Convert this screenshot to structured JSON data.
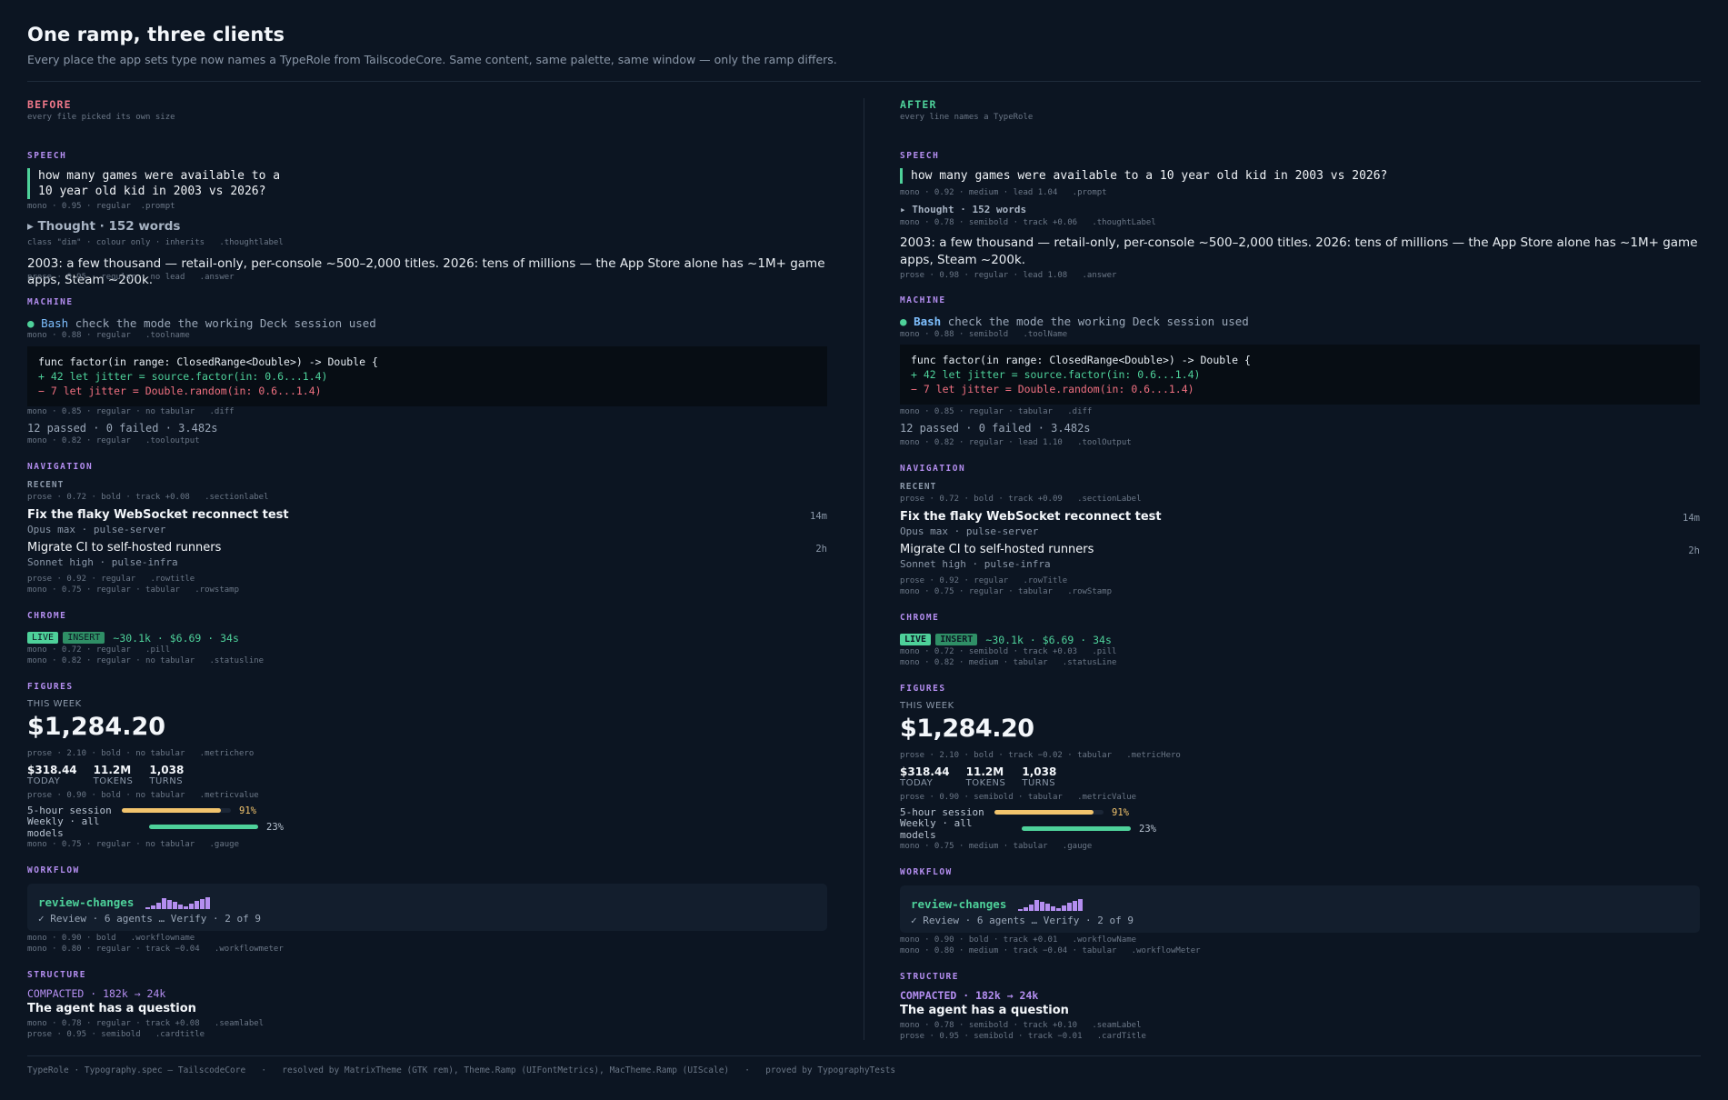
{
  "header": {
    "title": "One ramp, three clients",
    "subtitle": "Every place the app sets type now names a TypeRole from TailscodeCore. Same content, same palette, same window — only the ramp differs."
  },
  "sections": {
    "speech": "SPEECH",
    "machine": "MACHINE",
    "navigation": "NAVIGATION",
    "chrome": "CHROME",
    "figures": "FIGURES",
    "workflow": "WORKFLOW",
    "structure": "STRUCTURE"
  },
  "content": {
    "prompt_wrapped": [
      "how many games were available to a",
      "10 year old kid in 2003 vs 2026?"
    ],
    "prompt": "how many games were available to a 10 year old kid in 2003 vs 2026?",
    "thought": "▸ Thought · 152 words",
    "answer": "2003: a few thousand — retail-only, per-console ~500–2,000 titles. 2026: tens of millions — the App Store alone has ~1M+ game apps, Steam ~200k.",
    "tool_dot": "●",
    "tool_name": "Bash",
    "tool_args": "check the mode the working Deck session used",
    "diff": [
      "func factor(in range: ClosedRange<Double>) -> Double {",
      "+  42   let jitter = source.factor(in: 0.6...1.4)",
      "−   7   let jitter = Double.random(in: 0.6...1.4)"
    ],
    "tool_output": "12 passed · 0 failed · 3.482s",
    "recent_label": "RECENT",
    "rows": [
      {
        "title": "Fix the flaky WebSocket reconnect test",
        "sub": "Opus  max · pulse-server",
        "stamp": "14m"
      },
      {
        "title": "Migrate CI to self-hosted runners",
        "sub": "Sonnet  high · pulse-infra",
        "stamp": "2h"
      }
    ],
    "pill_live": "LIVE",
    "pill_insert": "INSERT",
    "statusline": "~30.1k · $6.69 · 34s",
    "this_week": "THIS WEEK",
    "metric_hero": "$1,284.20",
    "metrics": [
      {
        "value": "$318.44",
        "label": "TODAY"
      },
      {
        "value": "11.2M",
        "label": "TOKENS"
      },
      {
        "value": "1,038",
        "label": "TURNS"
      }
    ],
    "gauges": [
      {
        "label": "5-hour session",
        "pct_text": "91%",
        "fraction": 0.91,
        "color": "#f2c46d"
      },
      {
        "label": "Weekly · all models",
        "pct_text": "23%",
        "fraction": 1.0,
        "color": "#4ed19a"
      }
    ],
    "workflow_name": "review-changes",
    "workflow_meter": "✓ Review · 6 agents   … Verify · 2 of 9",
    "compacted": "COMPACTED · 182k → 24k",
    "card_title": "The agent has a question"
  },
  "before": {
    "label": "BEFORE",
    "label_color": "#f0788a",
    "sub": "every file picked its own size",
    "meta": {
      "prompt": "mono · 0.95 · regular  .prompt",
      "thought": "class \"dim\" · colour only · inherits   .thoughtlabel",
      "answer": "prose · 0.95 · regular · no lead   .answer",
      "toolname": "mono · 0.88 · regular   .toolname",
      "diff": "mono · 0.85 · regular · no tabular   .diff",
      "tooloutput": "mono · 0.82 · regular   .tooloutput",
      "sectionlabel": "prose · 0.72 · bold · track +0.08   .sectionlabel",
      "rowtitle": "prose · 0.92 · regular   .rowtitle",
      "rowstamp": "mono · 0.75 · regular · tabular   .rowstamp",
      "pill": "mono · 0.72 · regular   .pill",
      "statusline": "mono · 0.82 · regular · no tabular   .statusline",
      "metrichero": "prose · 2.10 · bold · no tabular   .metrichero",
      "metricvalue": "prose · 0.90 · bold · no tabular   .metricvalue",
      "gauge": "mono · 0.75 · regular · no tabular   .gauge",
      "workflowname": "mono · 0.90 · bold   .workflowname",
      "workflowmeter": "mono · 0.80 · regular · track −0.04   .workflowmeter",
      "seamlabel": "mono · 0.78 · regular · track +0.08   .seamlabel",
      "cardtitle": "prose · 0.95 · semibold   .cardtitle"
    }
  },
  "after": {
    "label": "AFTER",
    "label_color": "#4ed19a",
    "sub": "every line names a TypeRole",
    "meta": {
      "prompt": "mono · 0.92 · medium · lead 1.04   .prompt",
      "thought": "mono · 0.78 · semibold · track +0.06   .thoughtLabel",
      "answer": "prose · 0.98 · regular · lead 1.08   .answer",
      "toolname": "mono · 0.88 · semibold   .toolName",
      "diff": "mono · 0.85 · regular · tabular   .diff",
      "tooloutput": "mono · 0.82 · regular · lead 1.10   .toolOutput",
      "sectionlabel": "prose · 0.72 · bold · track +0.09   .sectionLabel",
      "rowtitle": "prose · 0.92 · regular   .rowTitle",
      "rowstamp": "mono · 0.75 · regular · tabular   .rowStamp",
      "pill": "mono · 0.72 · semibold · track +0.03   .pill",
      "statusline": "mono · 0.82 · medium · tabular   .statusLine",
      "metrichero": "prose · 2.10 · bold · track −0.02 · tabular   .metricHero",
      "metricvalue": "prose · 0.90 · semibold · tabular   .metricValue",
      "gauge": "mono · 0.75 · medium · tabular   .gauge",
      "workflowname": "mono · 0.90 · bold · track +0.01   .workflowName",
      "workflowmeter": "mono · 0.80 · medium · track −0.04 · tabular   .workflowMeter",
      "seamlabel": "mono · 0.78 · semibold · track +0.10   .seamLabel",
      "cardtitle": "prose · 0.95 · semibold · track −0.01   .cardTitle"
    }
  },
  "footer": "TypeRole · Typography.spec — TailscodeCore   ·   resolved by MatrixTheme (GTK rem), Theme.Ramp (UIFontMetrics), MacTheme.Ramp (UIScale)   ·   proved by TypographyTests"
}
